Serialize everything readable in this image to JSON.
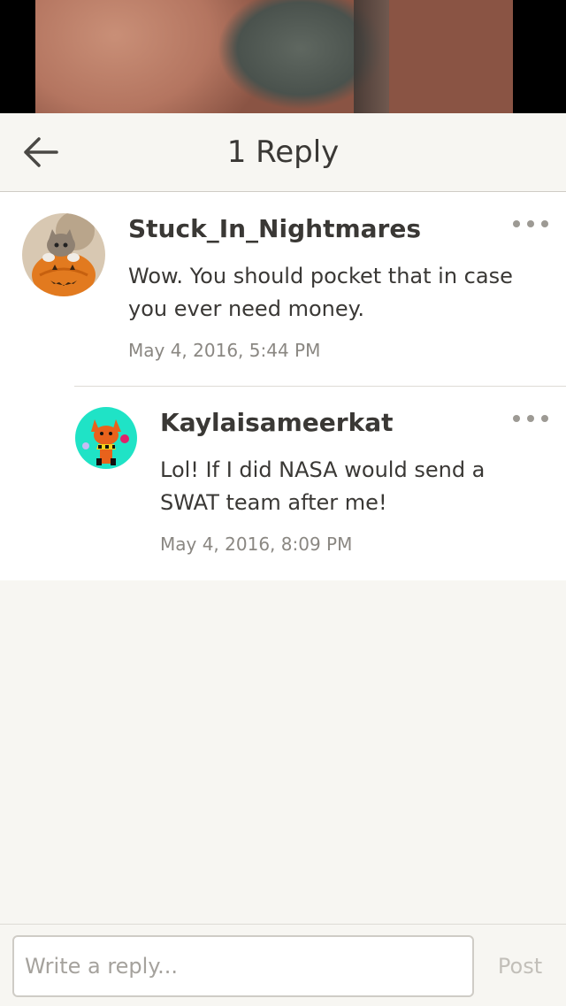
{
  "header": {
    "title": "1 Reply",
    "back_icon": "arrow-left-icon"
  },
  "thread": {
    "parent": {
      "username": "Stuck_In_Nightmares",
      "text": "Wow. You should pocket that in case you ever need money.",
      "timestamp": "May 4, 2016, 5:44 PM",
      "avatar_icon": "avatar-kitten-pumpkin"
    },
    "replies": [
      {
        "username": "Kaylaisameerkat",
        "text": "Lol! If I did NASA would send a SWAT team after me!",
        "timestamp": "May 4, 2016, 8:09 PM",
        "avatar_icon": "avatar-cartoon-fox"
      }
    ],
    "more_icon": "more-horizontal-icon"
  },
  "composer": {
    "placeholder": "Write a reply...",
    "value": "",
    "post_label": "Post"
  },
  "colors": {
    "background": "#f7f6f2",
    "card": "#ffffff",
    "text": "#3a3835",
    "muted": "#8a8782",
    "post_disabled": "#c2bfb9"
  }
}
